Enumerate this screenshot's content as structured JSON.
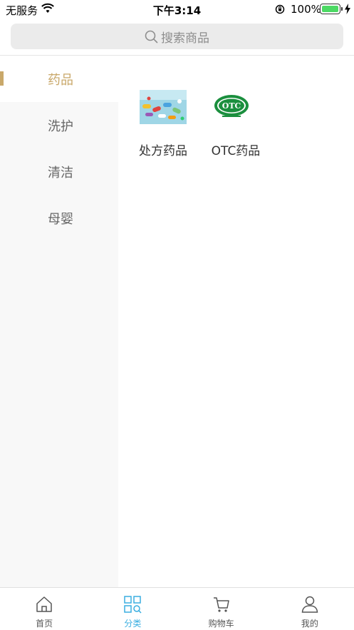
{
  "status_bar": {
    "carrier": "无服务",
    "time": "下午3:14",
    "battery": "100%"
  },
  "search": {
    "placeholder": "搜索商品"
  },
  "sidebar": {
    "items": [
      {
        "label": "药品",
        "active": true
      },
      {
        "label": "洗护",
        "active": false
      },
      {
        "label": "清洁",
        "active": false
      },
      {
        "label": "母婴",
        "active": false
      }
    ]
  },
  "categories": [
    {
      "label": "处方药品",
      "icon": "pills-image"
    },
    {
      "label": "OTC药品",
      "icon": "otc-logo",
      "logo_text": "OTC"
    }
  ],
  "tab_bar": {
    "tabs": [
      {
        "label": "首页",
        "icon": "home-icon",
        "active": false
      },
      {
        "label": "分类",
        "icon": "category-icon",
        "active": true
      },
      {
        "label": "购物车",
        "icon": "cart-icon",
        "active": false
      },
      {
        "label": "我的",
        "icon": "user-icon",
        "active": false
      }
    ]
  },
  "colors": {
    "accent": "#c9a86a",
    "tab_active": "#3aaee0",
    "otc_green": "#1b8f3e",
    "battery": "#4cd964"
  }
}
